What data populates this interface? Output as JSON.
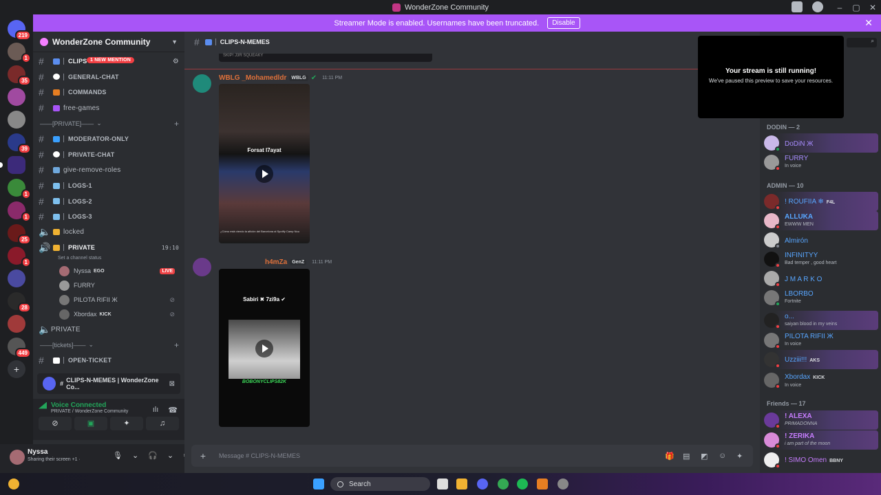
{
  "window": {
    "title": "WonderZone Community"
  },
  "banner": {
    "text": "Streamer Mode is enabled. Usernames have been truncated.",
    "disable_label": "Disable"
  },
  "guild_badges": [
    "219",
    "1",
    "35",
    "39",
    "1",
    "1",
    "25",
    "1",
    "28",
    "449"
  ],
  "server": {
    "name": "WonderZone Community"
  },
  "channels": [
    {
      "name": "clips-n-memes",
      "mention": "1 NEW MENTION"
    },
    {
      "name": "general-chat"
    },
    {
      "name": "commands"
    },
    {
      "name": "free-games"
    }
  ],
  "categories": {
    "private": "——[PRIVATE]——",
    "tickets": "——[tickets]——"
  },
  "private_channels": [
    {
      "name": "moderator-only"
    },
    {
      "name": "private-chat"
    },
    {
      "name": "give-remove-roles"
    },
    {
      "name": "logs-1"
    },
    {
      "name": "logs-2"
    },
    {
      "name": "logs-3"
    },
    {
      "name": "locked"
    }
  ],
  "voice_channel": {
    "name": "PRIVATE",
    "time": "19:10",
    "status": "Set a channel status"
  },
  "voice_users": [
    {
      "name": "Nyssa",
      "tag": "EGO",
      "live": "LIVE"
    },
    {
      "name": "FURRY",
      "tag": ""
    },
    {
      "name": "PILOTA RIFII Ж",
      "tag": ""
    },
    {
      "name": "Xbordax",
      "tag": "KICK"
    }
  ],
  "voice_channel2": {
    "name": "PRIVATE"
  },
  "ticket_channel": {
    "name": "open-ticket"
  },
  "popup": {
    "text": "CLIPS-N-MEMES | WonderZone Co..."
  },
  "voice_status": {
    "title": "Voice Connected",
    "sub": "PRIVATE / WonderZone Community"
  },
  "user": {
    "name": "Nyssa",
    "status": "Sharing their screen +1 ·"
  },
  "current_channel": {
    "name": "CLIPS-N-MEMES"
  },
  "prev_clip_caption": "SKIP! J3R SQUEAKY",
  "messages": [
    {
      "author": "WBLG _Mohamedldr",
      "tag": "WBLG",
      "time": "11:11 PM",
      "caption": "Forsat l7ayat",
      "subcaption": "¿Cómo está viendo la afición del Barcelona al Spotify Camp Nou"
    },
    {
      "author": "h4mZa",
      "tag": "GenZ",
      "time": "11:11 PM",
      "caption": "Sabiri ✖  7zi9a ✔",
      "watermark": "BOBONYCLIPS82K"
    }
  ],
  "composer": {
    "placeholder": "Message #  CLIPS-N-MEMES"
  },
  "stream_popup": {
    "title": "Your stream is still running!",
    "sub": "We've paused this preview to save your resources."
  },
  "member_sections": [
    {
      "label": "DODIN — 2",
      "members": [
        {
          "name": "DoDiN Ж",
          "sub": "",
          "tag": ""
        },
        {
          "name": "FURRY",
          "sub": "In voice",
          "tag": ""
        }
      ]
    },
    {
      "label": "ADMIN — 10",
      "members": [
        {
          "name": "! ROUFIIA ❄",
          "sub": "",
          "tag": "F4L"
        },
        {
          "name": "ALLUKA",
          "sub": "EWWW MEN",
          "tag": ""
        },
        {
          "name": "Almirón",
          "sub": "",
          "tag": ""
        },
        {
          "name": "INFINITYY",
          "sub": "Bad temper , good heart",
          "tag": ""
        },
        {
          "name": "J M A R K O",
          "sub": "",
          "tag": ""
        },
        {
          "name": "LBORBO",
          "sub": "Fortnite",
          "tag": ""
        },
        {
          "name": "o...",
          "sub": "saiyan blood in my veins",
          "tag": ""
        },
        {
          "name": "PILOTA RIFII Ж",
          "sub": "In voice",
          "tag": ""
        },
        {
          "name": "Uzziii!!!",
          "sub": "",
          "tag": "AKS"
        },
        {
          "name": "Xbordax",
          "sub": "In voice",
          "tag": "KICK"
        }
      ]
    },
    {
      "label": "Friends — 17",
      "members": [
        {
          "name": "! ALEXA",
          "sub": "PRIMADONNA",
          "tag": ""
        },
        {
          "name": "! ZERIKA",
          "sub": "i am part of the moon",
          "tag": ""
        },
        {
          "name": "! SIMO Omen",
          "sub": "",
          "tag": "BBNY"
        }
      ]
    }
  ],
  "taskbar": {
    "search_label": "Search"
  }
}
